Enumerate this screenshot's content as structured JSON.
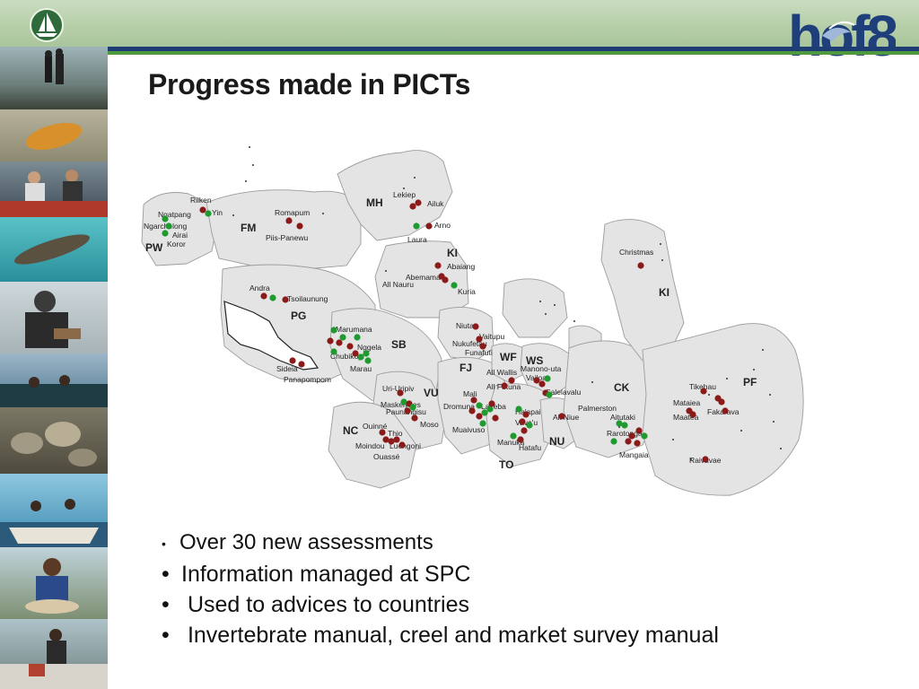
{
  "slide": {
    "title": "Progress made in PICTs",
    "logo_text": "hof8",
    "bullets": [
      "Over 30 new assessments",
      "Information managed at SPC",
      " Used to advices to countries",
      " Invertebrate manual, creel and market survey manual"
    ]
  },
  "map": {
    "colors": {
      "surveyed": "#8b1a1a",
      "other": "#1f9a2f",
      "zone_fill": "#e4e4e4",
      "zone_stroke": "#9c9c9c"
    },
    "country_labels": [
      "FM",
      "PW",
      "MH",
      "KI",
      "KI",
      "PG",
      "SB",
      "VU",
      "NC",
      "FJ",
      "WF",
      "WS",
      "TO",
      "NU",
      "CK",
      "PF"
    ],
    "site_labels": [
      "Riiken",
      "Ngatpang",
      "Ngarchelong",
      "Airai",
      "Koror",
      "Yin",
      "Romapum",
      "Piis-Panewu",
      "Lekiep",
      "Ailuk",
      "Arno",
      "Laura",
      "Abaiang",
      "Abemama",
      "All Nauru",
      "Kuria",
      "Christmas",
      "Andra",
      "Tsoilaunung",
      "Sideia",
      "Panapompom",
      "Marumana",
      "Nggela",
      "Chubikopi",
      "Marau",
      "Niutao",
      "Vaitupu",
      "Nukufetau",
      "Funafuti",
      "All Wallis",
      "All Futuna",
      "Manono-uta",
      "Vailoa",
      "Salelavalu",
      "Uri-Uripiv",
      "Maskelynes",
      "Paunangisu",
      "Moso",
      "Mali",
      "Dromuna",
      "Lakeba",
      "Muaivuso",
      "Ha'apai",
      "Vava'u",
      "Manuka",
      "Hatafu",
      "All Niue",
      "Ouinné",
      "Thio",
      "Moindou",
      "Luengoni",
      "Ouassé",
      "Palmerston",
      "Aitutaki",
      "Rarotonga",
      "Mangaia",
      "Tikehau",
      "Mataiea",
      "Maatea",
      "Fakarava",
      "Raivavae"
    ]
  }
}
